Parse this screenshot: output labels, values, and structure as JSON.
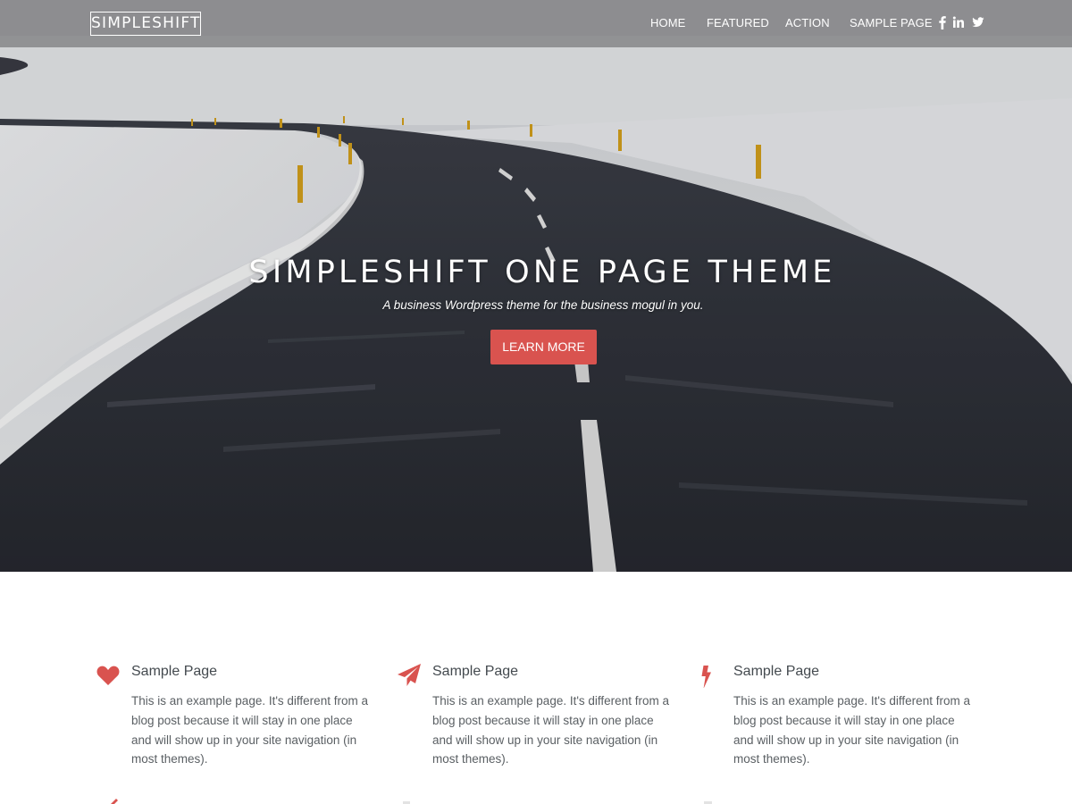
{
  "brand": {
    "logo_text": "SIMPLESHIFT",
    "accent_color": "#d9534f"
  },
  "nav": {
    "items": [
      {
        "label": "HOME"
      },
      {
        "label": "FEATURED"
      },
      {
        "label": "ACTION"
      },
      {
        "label": "SAMPLE PAGE"
      }
    ],
    "social": [
      {
        "icon": "facebook-icon"
      },
      {
        "icon": "linkedin-icon"
      },
      {
        "icon": "twitter-icon"
      }
    ]
  },
  "hero": {
    "title": "SIMPLESHIFT ONE PAGE THEME",
    "subtitle": "A business Wordpress theme for the business mogul in you.",
    "button_label": "LEARN MORE",
    "background": "snowy-road-photo"
  },
  "features": [
    {
      "icon": "heart-icon",
      "title": "Sample Page",
      "body": "This is an example page. It's different from a blog post because it will stay in one place and will show up in your site navigation (in most themes)."
    },
    {
      "icon": "paper-plane-icon",
      "title": "Sample Page",
      "body": "This is an example page. It's different from a blog post because it will stay in one place and will show up in your site navigation (in most themes)."
    },
    {
      "icon": "lightning-bolt-icon",
      "title": "Sample Page",
      "body": "This is an example page. It's different from a blog post because it will stay in one place and will show up in your site navigation (in most themes)."
    }
  ]
}
